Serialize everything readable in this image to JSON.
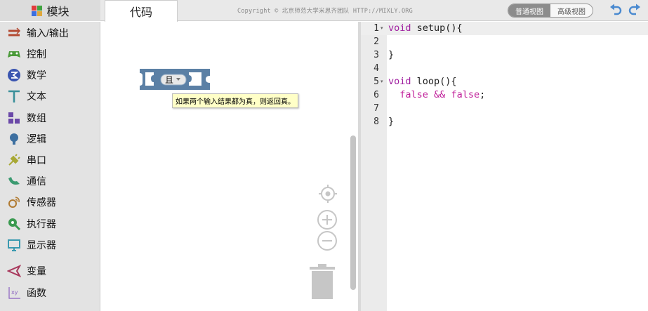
{
  "tabs": {
    "blocks": "模块",
    "code": "代码"
  },
  "copyright": "Copyright © 北京师范大学米思齐团队 HTTP://MIXLY.ORG",
  "view_toggle": {
    "normal": "普通视图",
    "advanced": "高级视图",
    "selected": "普通视图"
  },
  "sidebar": {
    "items": [
      {
        "label": "输入/输出",
        "icon": "io-arrows-icon",
        "color": "#b34a32"
      },
      {
        "label": "控制",
        "icon": "gamepad-icon",
        "color": "#4a9a3a"
      },
      {
        "label": "数学",
        "icon": "math-icon",
        "color": "#3a55b0"
      },
      {
        "label": "文本",
        "icon": "text-T-icon",
        "color": "#3a8f9a"
      },
      {
        "label": "数组",
        "icon": "array-blocks-icon",
        "color": "#6a48a8"
      },
      {
        "label": "逻辑",
        "icon": "bulb-icon",
        "color": "#3d6fa0"
      },
      {
        "label": "串口",
        "icon": "plug-icon",
        "color": "#a8a834"
      },
      {
        "label": "通信",
        "icon": "communication-icon",
        "color": "#3b9a70"
      },
      {
        "label": "传感器",
        "icon": "sensor-icon",
        "color": "#b07a30"
      },
      {
        "label": "执行器",
        "icon": "actuator-icon",
        "color": "#3a9a50"
      },
      {
        "label": "显示器",
        "icon": "monitor-icon",
        "color": "#3a9ab0"
      },
      {
        "label": "变量",
        "icon": "variable-icon",
        "color": "#a8385c"
      },
      {
        "label": "函数",
        "icon": "function-xy-icon",
        "color": "#8a60c0"
      }
    ]
  },
  "workspace": {
    "block": {
      "label": "且",
      "color": "#5b80a5"
    },
    "tooltip": "如果两个输入结果都为真，则返回真。"
  },
  "code": {
    "line_numbers": [
      "1",
      "2",
      "3",
      "4",
      "5",
      "6",
      "7",
      "8"
    ],
    "lines": [
      [
        {
          "t": "void",
          "c": "kw"
        },
        {
          "t": " setup(){",
          "c": ""
        }
      ],
      [],
      [
        {
          "t": "}",
          "c": ""
        }
      ],
      [],
      [
        {
          "t": "void",
          "c": "kw"
        },
        {
          "t": " loop(){",
          "c": ""
        }
      ],
      [
        {
          "t": "  ",
          "c": ""
        },
        {
          "t": "false",
          "c": "bool"
        },
        {
          "t": " ",
          "c": ""
        },
        {
          "t": "&&",
          "c": "op"
        },
        {
          "t": " ",
          "c": ""
        },
        {
          "t": "false",
          "c": "bool"
        },
        {
          "t": ";",
          "c": ""
        }
      ],
      [],
      [
        {
          "t": "}",
          "c": ""
        }
      ]
    ],
    "fold_lines": [
      1,
      5
    ]
  }
}
